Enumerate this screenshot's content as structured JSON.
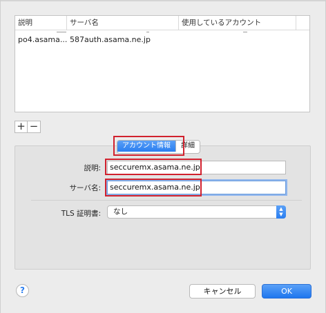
{
  "table": {
    "headers": [
      "説明",
      "サーバ名",
      "使用しているアカウント"
    ],
    "rows": [
      {
        "description": "po4.asama...",
        "server": "587auth.asama.ne.jp",
        "account": ""
      }
    ]
  },
  "list_buttons": {
    "add": "+",
    "remove": "−"
  },
  "tabs": [
    {
      "label": "アカウント情報",
      "active": true
    },
    {
      "label": "詳細",
      "active": false
    }
  ],
  "form": {
    "description_label": "説明:",
    "description_value": "seccuremx.asama.ne.jp",
    "server_label": "サーバ名:",
    "server_value": "seccuremx.asama.ne.jp",
    "tls_label": "TLS 証明書:",
    "tls_value": "なし"
  },
  "footer": {
    "help": "?",
    "cancel": "キャンセル",
    "ok": "OK"
  },
  "colors": {
    "accent": "#2a7ef0",
    "highlight_box": "#d1202d"
  },
  "icons": {
    "help": "question-mark-icon",
    "select_arrows": "chevron-updown-icon"
  }
}
